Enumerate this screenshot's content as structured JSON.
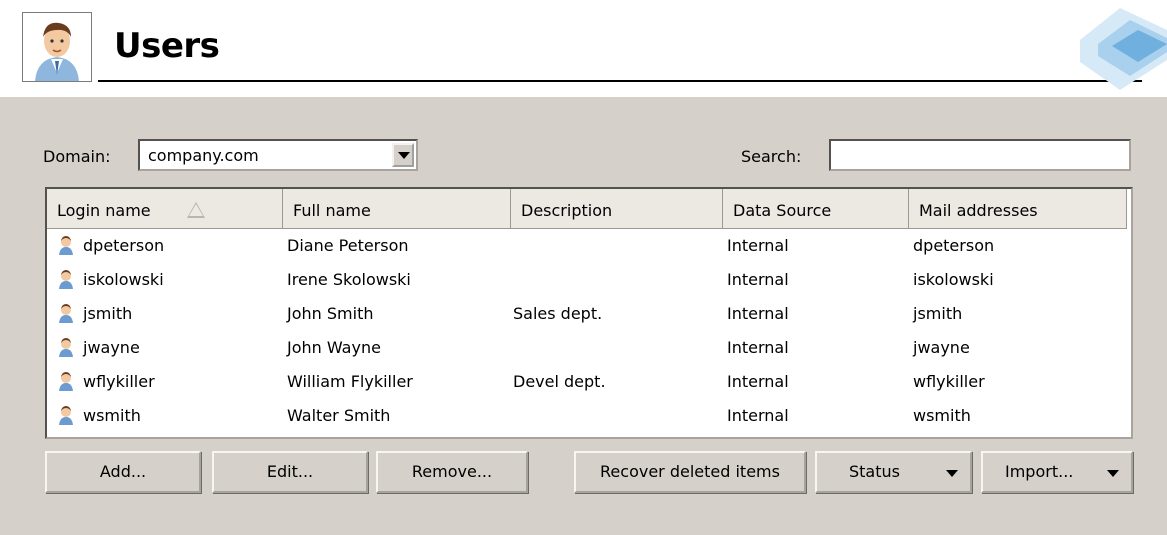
{
  "header": {
    "title": "Users",
    "photo_icon": "user-avatar-icon",
    "logo_icon": "brand-logo-icon"
  },
  "filters": {
    "domain_label": "Domain:",
    "domain_value": "company.com",
    "search_label": "Search:",
    "search_value": ""
  },
  "table": {
    "columns": [
      "Login name",
      "Full name",
      "Description",
      "Data Source",
      "Mail addresses"
    ],
    "sorted_column": "Login name",
    "sort_direction": "ascending",
    "rows": [
      {
        "login": "dpeterson",
        "full_name": "Diane Peterson",
        "description": "",
        "source": "Internal",
        "mail": "dpeterson"
      },
      {
        "login": "iskolowski",
        "full_name": "Irene Skolowski",
        "description": "",
        "source": "Internal",
        "mail": "iskolowski"
      },
      {
        "login": "jsmith",
        "full_name": "John Smith",
        "description": "Sales dept.",
        "source": "Internal",
        "mail": "jsmith"
      },
      {
        "login": "jwayne",
        "full_name": "John Wayne",
        "description": "",
        "source": "Internal",
        "mail": "jwayne"
      },
      {
        "login": "wflykiller",
        "full_name": "William Flykiller",
        "description": "Devel dept.",
        "source": "Internal",
        "mail": "wflykiller"
      },
      {
        "login": "wsmith",
        "full_name": "Walter Smith",
        "description": "",
        "source": "Internal",
        "mail": "wsmith"
      }
    ]
  },
  "buttons": {
    "add": "Add...",
    "edit": "Edit...",
    "remove": "Remove...",
    "recover": "Recover deleted items",
    "status": "Status",
    "import": "Import..."
  },
  "colors": {
    "panel_bg": "#d5d0c9",
    "header_bg": "#ece9e3"
  }
}
